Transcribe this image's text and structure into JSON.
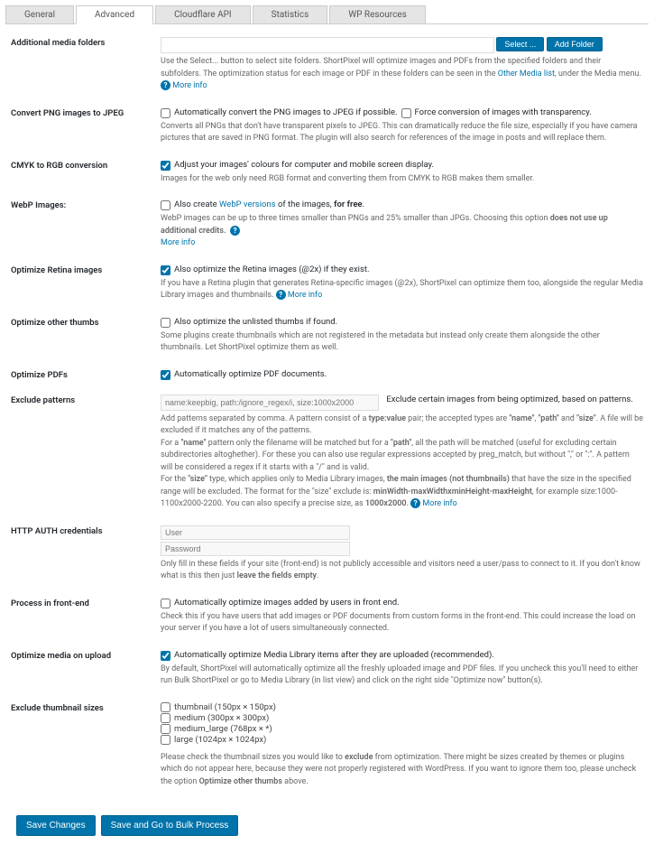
{
  "tabs": [
    "General",
    "Advanced",
    "Cloudflare API",
    "Statistics",
    "WP Resources"
  ],
  "activeTab": 1,
  "sections": {
    "folders": {
      "label": "Additional media folders",
      "select": "Select ...",
      "add": "Add Folder",
      "help_a": "Use the Select... button to select site folders. ShortPixel will optimize images and PDFs from the specified folders and their subfolders. The optimization status for each image or PDF in these folders can be seen in the ",
      "link": "Other Media list",
      "help_b": ", under the Media menu. ",
      "more": "More info"
    },
    "png": {
      "label": "Convert PNG images to JPEG",
      "cb1": "Automatically convert the PNG images to JPEG if possible.",
      "cb2": "Force conversion of images with transparency.",
      "help": "Converts all PNGs that don't have transparent pixels to JPEG. This can dramatically reduce the file size, especially if you have camera pictures that are saved in PNG format. The plugin will also search for references of the image in posts and will replace them."
    },
    "cmyk": {
      "label": "CMYK to RGB conversion",
      "cb": "Adjust your images' colours for computer and mobile screen display.",
      "help": "Images for the web only need RGB format and converting them from CMYK to RGB makes them smaller."
    },
    "webp": {
      "label": "WebP Images:",
      "cb_a": "Also create ",
      "link": "WebP versions",
      "cb_b": " of the images, ",
      "cb_c": "for free",
      "cb_d": ".",
      "help_a": "WebP images can be up to three times smaller than PNGs and 25% smaller than JPGs. Choosing this option ",
      "help_b": "does not use up additional credits.",
      "more": "More info"
    },
    "retina": {
      "label": "Optimize Retina images",
      "cb": "Also optimize the Retina images (@2x) if they exist.",
      "help": "If you have a Retina plugin that generates Retina-specific images (@2x), ShortPixel can optimize them too, alongside the regular Media Library images and thumbnails. ",
      "more": "More info"
    },
    "other": {
      "label": "Optimize other thumbs",
      "cb": "Also optimize the unlisted thumbs if found.",
      "help": "Some plugins create thumbnails which are not registered in the metadata but instead only create them alongside the other thumbnails. Let ShortPixel optimize them as well."
    },
    "pdf": {
      "label": "Optimize PDFs",
      "cb": "Automatically optimize PDF documents."
    },
    "exclude": {
      "label": "Exclude patterns",
      "placeholder": "name:keepbig, path:/ignore_regex/i, size:1000x2000",
      "side": "Exclude certain images from being optimized, based on patterns.",
      "help_a": "Add patterns separated by comma. A pattern consist of a ",
      "b1": "type:value",
      "help_b": " pair; the accepted types are ",
      "b2": "\"name\"",
      "b3": "\"path\"",
      "and": " and ",
      "b4": "\"size\"",
      "help_c": ". A file will be excluded if it matches any of the patterns.",
      "help_d": "For a ",
      "b5": "\"name\"",
      "help_e": " pattern only the filename will be matched but for a ",
      "b6": "\"path\"",
      "help_f": ", all the path will be matched (useful for excluding certain subdirectories altoghether). For these you can also use regular expressions accepted by preg_match, but without \",\" or \":\". A pattern will be considered a regex if it starts with a \"/\" and is valid.",
      "help_g": "For the ",
      "b7": "\"size\"",
      "help_h": " type, which applies only to Media Library images, ",
      "b8": "the main images (not thumbnails)",
      "help_i": " that have the size in the specified range will be excluded. The format for the \"size\" exclude is: ",
      "b9": "minWidth-maxWidthxminHeight-maxHeight",
      "help_j": ", for example size:1000-1100x2000-2200. You can also specify a precise size, as ",
      "b10": "1000x2000",
      "help_k": ". ",
      "more": "More info"
    },
    "auth": {
      "label": "HTTP AUTH credentials",
      "user": "User",
      "pass": "Password",
      "help_a": "Only fill in these fields if your site (front-end) is not publicly accessible and visitors need a user/pass to connect to it. If you don't know what is this then just ",
      "b": "leave the fields empty",
      "help_b": "."
    },
    "front": {
      "label": "Process in front-end",
      "cb": "Automatically optimize images added by users in front end.",
      "help": "Check this if you have users that add images or PDF documents from custom forms in the front-end. This could increase the load on your server if you have a lot of users simultaneously connected."
    },
    "upload": {
      "label": "Optimize media on upload",
      "cb": "Automatically optimize Media Library items after they are uploaded (recommended).",
      "help": "By default, ShortPixel will automatically optimize all the freshly uploaded image and PDF files. If you uncheck this you'll need to either run Bulk ShortPixel or go to Media Library (in list view) and click on the right side \"Optimize now\" button(s)."
    },
    "thumbs": {
      "label": "Exclude thumbnail sizes",
      "items": [
        "thumbnail (150px × 150px)",
        "medium (300px × 300px)",
        "medium_large (768px × *)",
        "large (1024px × 1024px)"
      ],
      "help_a": "Please check the thumbnail sizes you would like to ",
      "b1": "exclude",
      "help_b": " from optimization. There might be sizes created by themes or plugins which do not appear here, because they were not properly registered with WordPress. If you want to ignore them too, please uncheck the option ",
      "b2": "Optimize other thumbs",
      "help_c": " above."
    }
  },
  "buttons": {
    "save": "Save Changes",
    "bulk": "Save and Go to Bulk Process"
  }
}
